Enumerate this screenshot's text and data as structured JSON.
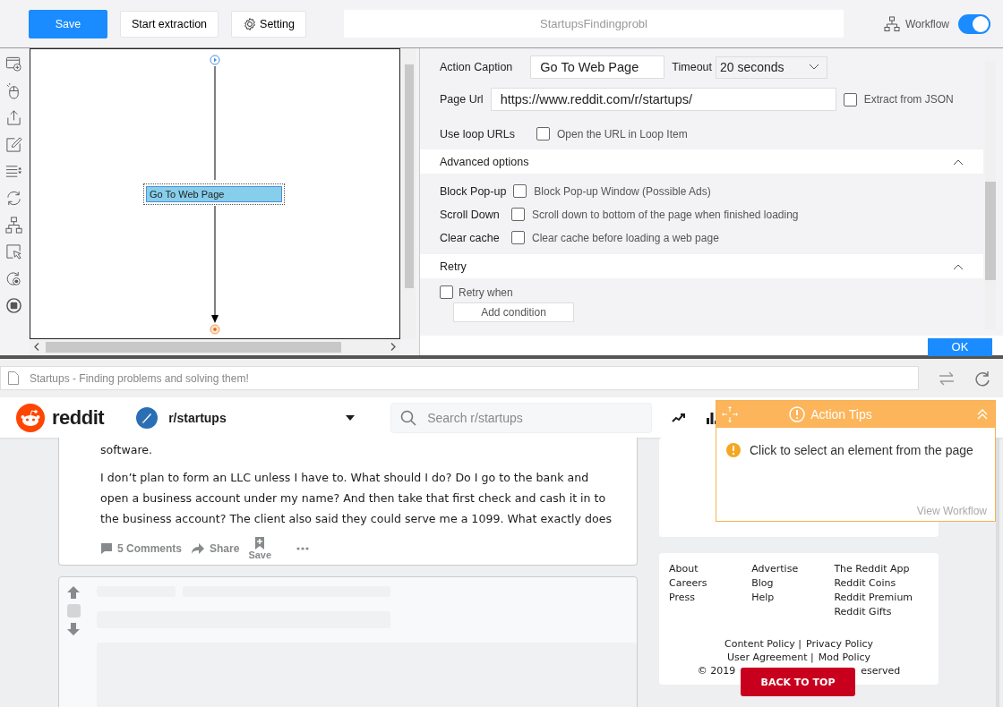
{
  "toolbar": {
    "buttons": [
      {
        "label": "Save",
        "kind": "primary"
      },
      {
        "label": "Start extraction",
        "kind": "plain"
      },
      {
        "label": "Setting",
        "kind": "settings"
      }
    ],
    "task_name": "StartupsFindingprobl",
    "workflow": {
      "label": "Workflow",
      "on": true
    }
  },
  "workflow_canvas": {
    "nodes": [
      {
        "label": "Go To Web Page",
        "selected": true
      }
    ]
  },
  "action_panel": {
    "action_caption": {
      "label": "Action Caption",
      "value": "Go To Web Page"
    },
    "timeout": {
      "label": "Timeout",
      "value": "20 seconds"
    },
    "page_url": {
      "label": "Page Url",
      "value": "https://www.reddit.com/r/startups/"
    },
    "extract_from_json": {
      "label": "Extract from JSON",
      "checked": false
    },
    "use_loop_urls": {
      "label": "Use loop URLs",
      "option": "Open the URL in Loop Item",
      "checked": false
    },
    "advanced_options": {
      "title": "Advanced options",
      "expanded": true,
      "options": [
        {
          "label": "Block Pop-up",
          "description": "Block Pop-up Window (Possible Ads)",
          "checked": false
        },
        {
          "label": "Scroll Down",
          "description": "Scroll down to bottom of the page when finished loading",
          "checked": false
        },
        {
          "label": "Clear cache",
          "description": "Clear cache before loading a web page",
          "checked": false
        }
      ]
    },
    "retry": {
      "title": "Retry",
      "expanded": true,
      "retry_when": {
        "label": "Retry when",
        "checked": false
      },
      "add_condition": "Add condition"
    },
    "ok_button": "OK"
  },
  "browser": {
    "page_title": "Startups - Finding problems and solving them!"
  },
  "reddit": {
    "logo": "reddit",
    "community": "r/startups",
    "search_placeholder": "Search r/startups",
    "post": {
      "paragraphs": [
        [
          "software."
        ],
        [
          "I don’t plan to form an LLC unless I have to. What should I do? Do I go to the bank and",
          "open a business account under my name? And then take that first check and cash it in to",
          "the business account? The client also said they could serve me a 1099. What exactly does"
        ]
      ],
      "actions": [
        {
          "label": "5 Comments",
          "kind": "comments"
        },
        {
          "label": "Share",
          "kind": "share"
        },
        {
          "label": "Save",
          "kind": "save"
        }
      ]
    },
    "footer": {
      "columns": [
        [
          "About",
          "Careers",
          "Press"
        ],
        [
          "Advertise",
          "Blog",
          "Help"
        ],
        [
          "The Reddit App",
          "Reddit Coins",
          "Reddit Premium",
          "Reddit Gifts"
        ]
      ],
      "policy_lines": [
        [
          "Content Policy |",
          "Privacy Policy"
        ],
        [
          "User Agreement |",
          "Mod Policy"
        ]
      ],
      "copyright": [
        "© 2019",
        "eserved"
      ]
    },
    "back_to_top": "BACK TO TOP"
  },
  "action_tips": {
    "title": "Action Tips",
    "expanded": true,
    "message": "Click to select an element from the page",
    "link": "View Workflow"
  }
}
